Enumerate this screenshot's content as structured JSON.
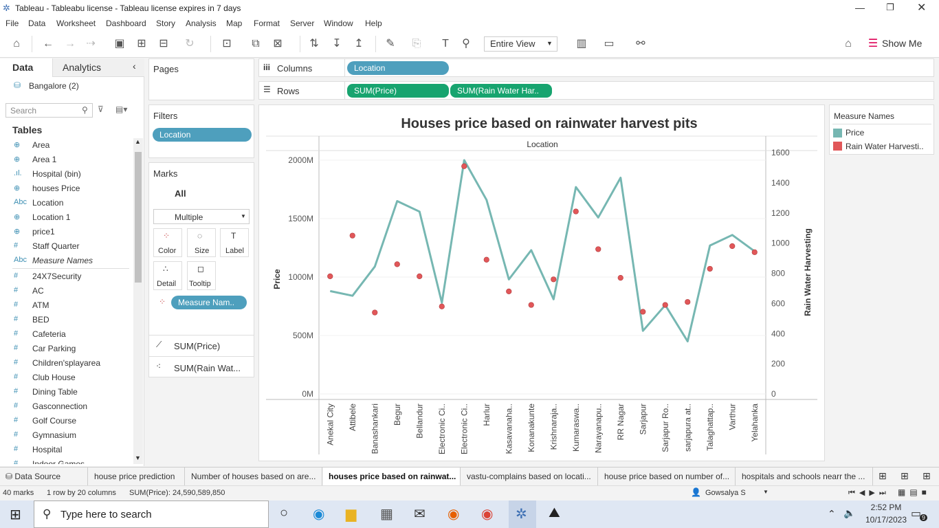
{
  "window": {
    "title": "Tableau - Tableabu license - Tableau license expires in 7 days"
  },
  "menu": [
    "File",
    "Data",
    "Worksheet",
    "Dashboard",
    "Story",
    "Analysis",
    "Map",
    "Format",
    "Server",
    "Window",
    "Help"
  ],
  "toolbar": {
    "fit": "Entire View",
    "show_me": "Show Me"
  },
  "left": {
    "tab_data": "Data",
    "tab_analytics": "Analytics",
    "datasource": "Bangalore (2)",
    "search_placeholder": "Search",
    "tables": "Tables",
    "fields": [
      {
        "icon": "⊕",
        "name": "Area"
      },
      {
        "icon": "⊕",
        "name": "Area 1"
      },
      {
        "icon": ".ıl.",
        "name": "Hospital (bin)"
      },
      {
        "icon": "⊕",
        "name": "houses Price"
      },
      {
        "icon": "Abc",
        "name": "Location"
      },
      {
        "icon": "⊕",
        "name": "Location 1"
      },
      {
        "icon": "⊕",
        "name": "price1"
      },
      {
        "icon": "#",
        "name": "Staff Quarter"
      },
      {
        "icon": "Abc",
        "name": "Measure Names"
      },
      {
        "icon": "#",
        "name": "24X7Security"
      },
      {
        "icon": "#",
        "name": "AC"
      },
      {
        "icon": "#",
        "name": "ATM"
      },
      {
        "icon": "#",
        "name": "BED"
      },
      {
        "icon": "#",
        "name": "Cafeteria"
      },
      {
        "icon": "#",
        "name": "Car Parking"
      },
      {
        "icon": "#",
        "name": "Children'splayarea"
      },
      {
        "icon": "#",
        "name": "Club House"
      },
      {
        "icon": "#",
        "name": "Dining Table"
      },
      {
        "icon": "#",
        "name": "Gasconnection"
      },
      {
        "icon": "#",
        "name": "Golf Course"
      },
      {
        "icon": "#",
        "name": "Gymnasium"
      },
      {
        "icon": "#",
        "name": "Hospital"
      },
      {
        "icon": "#",
        "name": "Indoor Games"
      }
    ]
  },
  "cards": {
    "pages": "Pages",
    "filters": "Filters",
    "filter_pill": "Location",
    "marks": "Marks",
    "all": "All",
    "mark_type": "Multiple",
    "color": "Color",
    "size": "Size",
    "label": "Label",
    "detail": "Detail",
    "tooltip": "Tooltip",
    "mn_pill": "Measure Nam..",
    "sum_price": "SUM(Price)",
    "sum_rain": "SUM(Rain Wat..."
  },
  "shelves": {
    "columns": "Columns",
    "rows": "Rows",
    "col_pill": "Location",
    "row_pill1": "SUM(Price)",
    "row_pill2": "SUM(Rain Water Har.."
  },
  "legend": {
    "title": "Measure Names",
    "items": [
      {
        "name": "Price",
        "color": "#76b7b2"
      },
      {
        "name": "Rain Water Harvesti..",
        "color": "#e15759"
      }
    ]
  },
  "chart_data": {
    "type": "line",
    "title": "Houses price based on rainwater harvest pits",
    "column_header": "Location",
    "categories": [
      "Anekal City",
      "Attibele",
      "Banashankari",
      "Begur",
      "Bellandur",
      "Electronic Ci..",
      "Electronic Ci..",
      "Harlur",
      "Kasavanaha..",
      "Konanakunte",
      "Krishnaraja..",
      "Kumaraswa..",
      "Narayanapu..",
      "RR Nagar",
      "Sarjapur",
      "Sarjapur Ro..",
      "sarjapura at..",
      "Talaghattap..",
      "Varthur",
      "Yelahanka"
    ],
    "series": [
      {
        "name": "Price",
        "axis": "left",
        "mark": "line",
        "color": "#76b7b2",
        "values": [
          880,
          840,
          1090,
          1650,
          1560,
          780,
          2000,
          1660,
          980,
          1230,
          810,
          1770,
          1510,
          1850,
          540,
          760,
          450,
          1270,
          1360,
          1220
        ]
      },
      {
        "name": "Rain Water Harvesting",
        "axis": "right",
        "mark": "circle",
        "color": "#e15759",
        "values": [
          780,
          1050,
          540,
          860,
          780,
          580,
          1510,
          890,
          680,
          590,
          760,
          1210,
          960,
          770,
          545,
          590,
          610,
          830,
          980,
          940
        ]
      }
    ],
    "y_left": {
      "label": "Price",
      "range": [
        0,
        2000
      ],
      "ticks": [
        "0M",
        "500M",
        "1000M",
        "1500M",
        "2000M"
      ]
    },
    "y_right": {
      "label": "Rain Water Harvesting",
      "range": [
        0,
        1550
      ],
      "ticks": [
        "0",
        "200",
        "400",
        "600",
        "800",
        "1000",
        "1200",
        "1400",
        "1600"
      ]
    }
  },
  "tabs": [
    "Data Source",
    "house price prediction",
    "Number of houses based on are...",
    "houses price based on rainwat...",
    "vastu-complains based on locati...",
    "house price based on number of...",
    "hospitals and schools nearr the ..."
  ],
  "status": {
    "marks": "40 marks",
    "dims": "1 row by 20 columns",
    "sum": "SUM(Price): 24,590,589,850",
    "user": "Gowsalya S"
  },
  "taskbar": {
    "search_placeholder": "Type here to search",
    "time": "2:52 PM",
    "date": "10/17/2023",
    "notif": "9"
  }
}
